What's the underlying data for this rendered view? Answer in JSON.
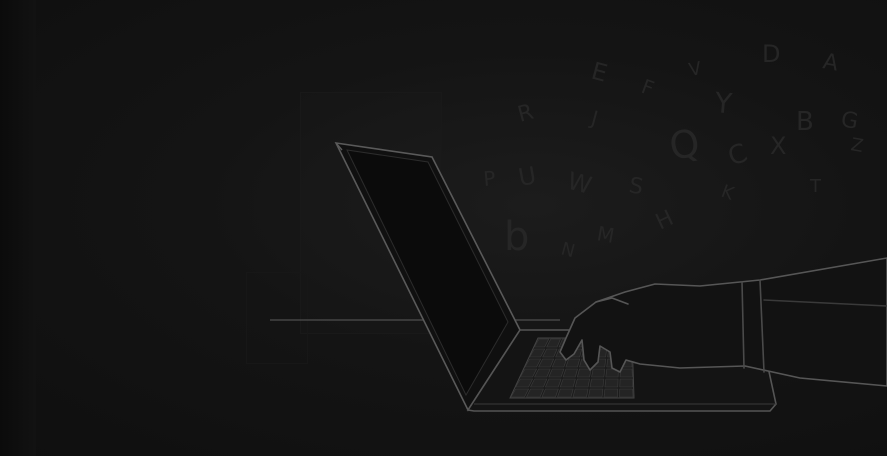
{
  "scene": {
    "background_color": "#111111",
    "line_color": "#4a4a4a",
    "letter_color": "#262626",
    "subject": "laptop-typing-illustration"
  },
  "floating_letters": [
    {
      "char": "A",
      "size": 22,
      "rot": 10
    },
    {
      "char": "R",
      "size": 22,
      "rot": -15
    },
    {
      "char": "D",
      "size": 24,
      "rot": 0
    },
    {
      "char": "Y",
      "size": 28,
      "rot": 5
    },
    {
      "char": "F",
      "size": 20,
      "rot": 20
    },
    {
      "char": "V",
      "size": 18,
      "rot": -10
    },
    {
      "char": "J",
      "size": 20,
      "rot": 15
    },
    {
      "char": "Q",
      "size": 38,
      "rot": -10
    },
    {
      "char": "X",
      "size": 24,
      "rot": 0
    },
    {
      "char": "E",
      "size": 24,
      "rot": 15
    },
    {
      "char": "C",
      "size": 26,
      "rot": -20
    },
    {
      "char": "G",
      "size": 22,
      "rot": 10
    },
    {
      "char": "P",
      "size": 20,
      "rot": -5
    },
    {
      "char": "W",
      "size": 24,
      "rot": 15
    },
    {
      "char": "B",
      "size": 26,
      "rot": 0
    },
    {
      "char": "S",
      "size": 22,
      "rot": 10
    },
    {
      "char": "U",
      "size": 24,
      "rot": -10
    },
    {
      "char": "K",
      "size": 18,
      "rot": 20
    },
    {
      "char": "T",
      "size": 18,
      "rot": 0
    },
    {
      "char": "b",
      "size": 40,
      "rot": 0
    },
    {
      "char": "N",
      "size": 18,
      "rot": 15
    },
    {
      "char": "H",
      "size": 22,
      "rot": -25
    },
    {
      "char": "M",
      "size": 20,
      "rot": 10
    },
    {
      "char": "Z",
      "size": 18,
      "rot": 10
    }
  ]
}
